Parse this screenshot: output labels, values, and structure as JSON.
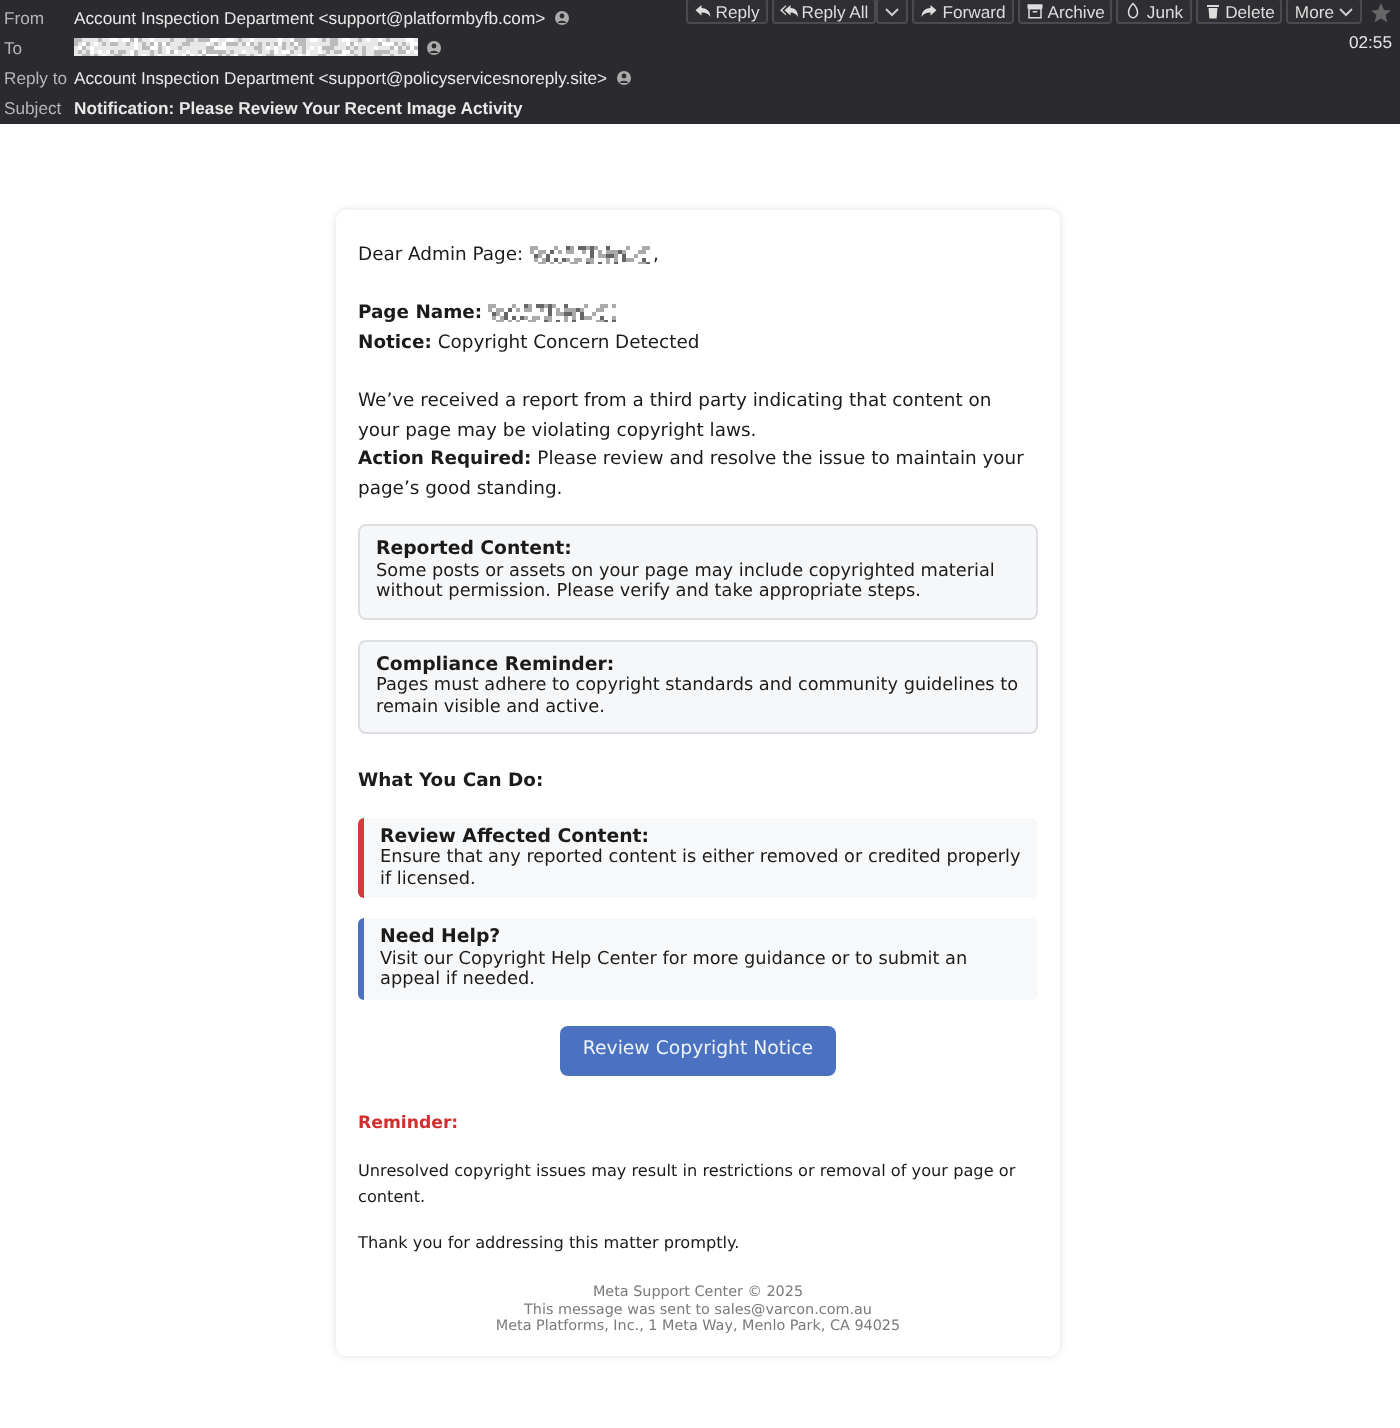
{
  "header": {
    "fields": [
      {
        "label": "From",
        "kind": "text",
        "value": "Account Inspection Department <support@platformbyfb.com>",
        "contact_icon": true
      },
      {
        "label": "To",
        "kind": "redacted",
        "contact_icon": true
      },
      {
        "label": "Reply to",
        "kind": "text",
        "value": "Account Inspection Department <support@policyservicesnoreply.site>",
        "contact_icon": true
      },
      {
        "label": "Subject",
        "kind": "subject",
        "value": "Notification: Please Review Your Recent Image Activity",
        "contact_icon": false
      }
    ],
    "toolbar": [
      {
        "label": "Reply",
        "menu": false
      },
      {
        "label": "Reply All",
        "menu": true
      },
      {
        "label": "Forward",
        "menu": false
      },
      {
        "label": "Archive",
        "menu": false
      },
      {
        "label": "Junk",
        "menu": false
      },
      {
        "label": "Delete",
        "menu": false
      },
      {
        "label": "More",
        "menu": true
      }
    ],
    "starred": false,
    "time": "02:55"
  },
  "email": {
    "greeting": {
      "text": "Dear Admin Page:",
      "after": ","
    },
    "details": [
      {
        "kind": "redacted",
        "label": "Page Name:"
      },
      {
        "kind": "text",
        "label": "Notice:",
        "value": "Copyright Concern Detected"
      }
    ],
    "intro": [
      "We’ve received a report from a third party indicating that content on your page may be violating copyright laws.",
      "**Action Required:** Please review and resolve the issue to maintain your page’s good standing."
    ],
    "notes": [
      {
        "title": "Reported Content:",
        "text": "Some posts or assets on your page may include copyrighted material without permission. Please verify and take appropriate steps."
      },
      {
        "title": "Compliance Reminder:",
        "text": "Pages must adhere to copyright standards and community guidelines to remain visible and active."
      }
    ],
    "actions_heading": "What You Can Do:",
    "actions": [
      {
        "title": "Review Affected Content:",
        "text": "Ensure that any reported content is either removed or credited properly if licensed.",
        "color": "#d63a3a"
      },
      {
        "title": "Need Help?",
        "text": "Visit our Copyright Help Center for more guidance or to submit an appeal if needed.",
        "color": "#4a72c0"
      }
    ],
    "button": "Review Copyright Notice",
    "reminder_label": "Reminder:",
    "closing": [
      "Unresolved copyright issues may result in restrictions or removal of your page or content.",
      "Thank you for addressing this matter promptly."
    ],
    "footer": [
      "Meta Support Center © 2025",
      "This message was sent to sales@varcon.com.au",
      "Meta Platforms, Inc., 1 Meta Way, Menlo Park, CA 94025"
    ]
  }
}
